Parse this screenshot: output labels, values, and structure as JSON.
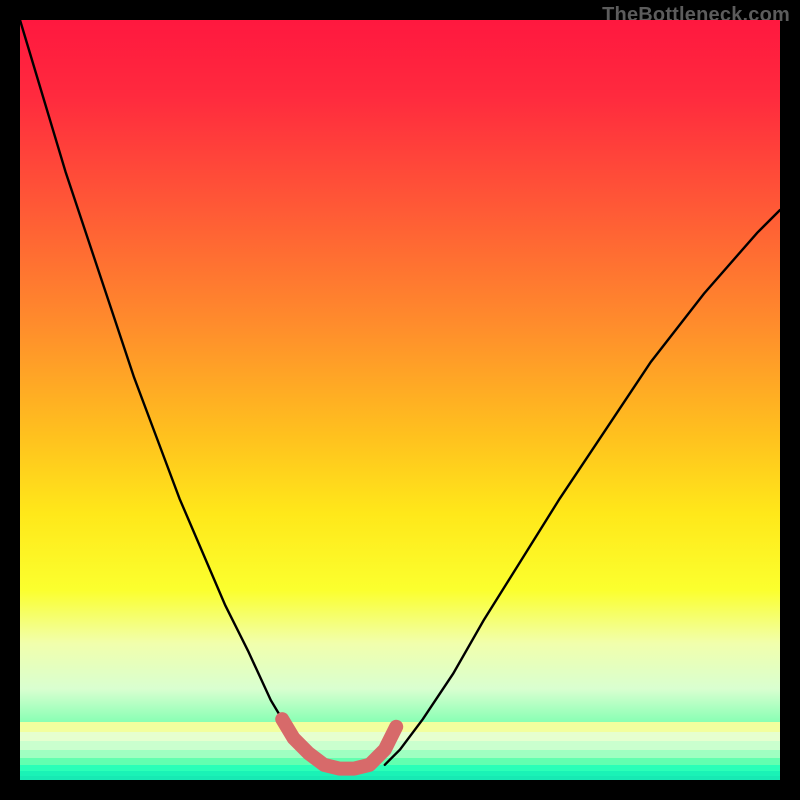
{
  "watermark": "TheBottleneck.com",
  "colors": {
    "frame_bg": "#000000",
    "curve_stroke": "#000000",
    "marker_stroke": "#d76a6a",
    "gradient_stops": [
      "#ff183f",
      "#ff2a3e",
      "#ff5a36",
      "#ff8c2c",
      "#ffc21e",
      "#ffe81a",
      "#fbff2e",
      "#f1ffac",
      "#d9ffd0",
      "#7dffb0",
      "#1dffb7",
      "#18f5b6"
    ]
  },
  "chart_data": {
    "type": "line",
    "title": "",
    "xlabel": "",
    "ylabel": "",
    "xlim": [
      0,
      100
    ],
    "ylim": [
      0,
      100
    ],
    "note": "Axes are implicit (no tick labels rendered). Values are estimated from pixel positions relative to the 760×760 plot area; y measured upward from bottom edge.",
    "series": [
      {
        "name": "left-curve",
        "x": [
          0,
          3,
          6,
          9,
          12,
          15,
          18,
          21,
          24,
          27,
          30,
          33,
          34.5,
          36,
          38,
          40
        ],
        "y": [
          100,
          90,
          80,
          71,
          62,
          53,
          45,
          37,
          30,
          23,
          17,
          10.5,
          8,
          5.5,
          3.5,
          2
        ]
      },
      {
        "name": "right-curve",
        "x": [
          48,
          50,
          53,
          57,
          61,
          66,
          71,
          77,
          83,
          90,
          97,
          100
        ],
        "y": [
          2,
          4,
          8,
          14,
          21,
          29,
          37,
          46,
          55,
          64,
          72,
          75
        ]
      },
      {
        "name": "optimal-marker",
        "x": [
          34.5,
          36,
          38,
          40,
          42,
          44,
          46,
          48,
          49.5
        ],
        "y": [
          8,
          5.5,
          3.5,
          2,
          1.5,
          1.5,
          2,
          4,
          7
        ]
      }
    ],
    "stripes_from_bottom": [
      {
        "h": 4,
        "color": "#18e9b4"
      },
      {
        "h": 5,
        "color": "#1af2b6"
      },
      {
        "h": 6,
        "color": "#2bffb8"
      },
      {
        "h": 7,
        "color": "#63ffb0"
      },
      {
        "h": 8,
        "color": "#9fffc1"
      },
      {
        "h": 9,
        "color": "#caffce"
      },
      {
        "h": 9,
        "color": "#e6ffcf"
      },
      {
        "h": 10,
        "color": "#f2ff9e"
      }
    ]
  }
}
